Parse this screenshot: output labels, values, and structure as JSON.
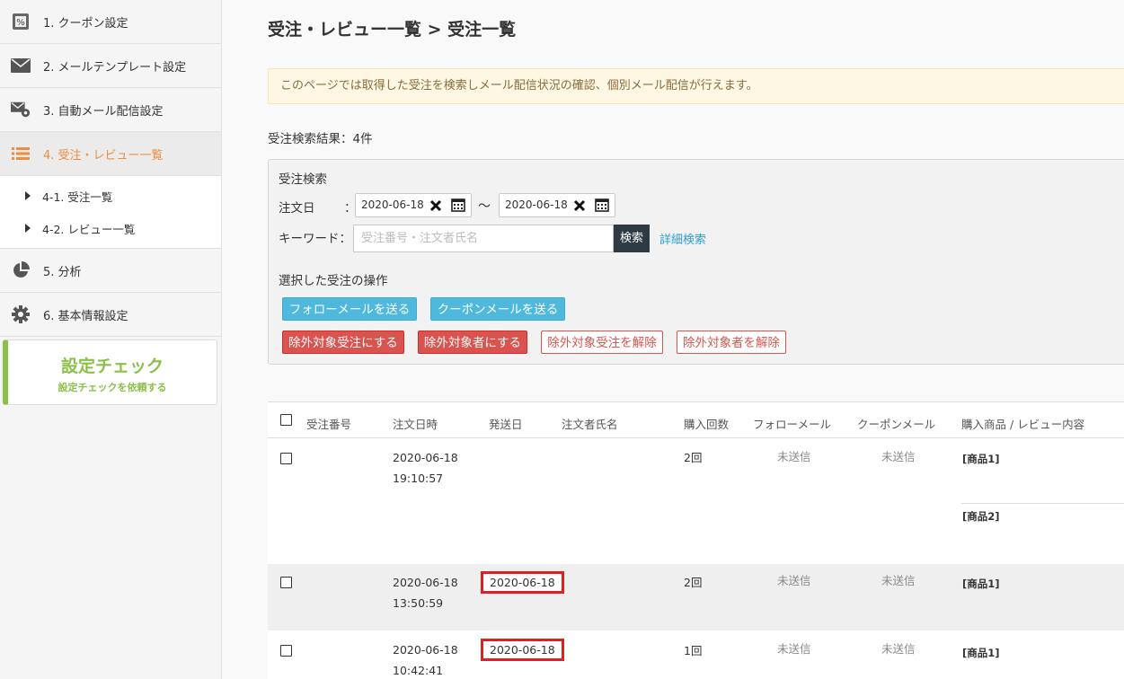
{
  "sidebar": {
    "items": [
      {
        "label": "1. クーポン設定",
        "icon": "coupon-icon"
      },
      {
        "label": "2. メールテンプレート設定",
        "icon": "mail-icon"
      },
      {
        "label": "3. 自動メール配信設定",
        "icon": "mail-gear-icon"
      },
      {
        "label": "4. 受注・レビュー一覧",
        "icon": "list-icon"
      },
      {
        "label": "5. 分析",
        "icon": "pie-chart-icon"
      },
      {
        "label": "6. 基本情報設定",
        "icon": "gear-icon"
      }
    ],
    "sub_items": [
      {
        "label": "4-1. 受注一覧"
      },
      {
        "label": "4-2. レビュー一覧"
      }
    ],
    "check": {
      "title": "設定チェック",
      "subtitle": "設定チェックを依頼する",
      "accent": "#8ac249"
    },
    "active_color": "#f08c3c"
  },
  "main": {
    "title": "受注・レビュー一覧 > 受注一覧",
    "notice": "このページでは取得した受注を検索しメール配信状況の確認、個別メール配信が行えます。",
    "result_count": "受注検索結果：4件"
  },
  "search": {
    "title": "受注検索",
    "date_label": "注文日",
    "colon": "：",
    "date_from": "2020-06-18",
    "date_to": "2020-06-18",
    "tilde": "～",
    "keyword_label": "キーワード：",
    "keyword_placeholder": "受注番号・注文者氏名",
    "search_button": "検索",
    "detail_link": "詳細検索",
    "ops_title": "選択した受注の操作",
    "buttons": {
      "follow_mail": "フォローメールを送る",
      "coupon_mail": "クーポンメールを送る",
      "exclude_order": "除外対象受注にする",
      "exclude_person": "除外対象者にする",
      "unexclude_order": "除外対象受注を解除",
      "unexclude_person": "除外対象者を解除"
    }
  },
  "table": {
    "headers": {
      "order_no": "受注番号",
      "order_date": "注文日時",
      "ship_date": "発送日",
      "name": "注文者氏名",
      "count": "購入回数",
      "follow": "フォローメール",
      "coupon": "クーポンメール",
      "product": "購入商品 / レビュー内容"
    },
    "rows": [
      {
        "date": "2020-06-18",
        "time": "19:10:57",
        "ship": "",
        "count": "2回",
        "follow": "未送信",
        "coupon": "未送信",
        "product1": "[商品1]",
        "product2": "[商品2]"
      },
      {
        "date": "2020-06-18",
        "time": "13:50:59",
        "ship": "2020-06-18",
        "count": "2回",
        "follow": "未送信",
        "coupon": "未送信",
        "product1": "[商品1]"
      },
      {
        "date": "2020-06-18",
        "time": "10:42:41",
        "ship": "2020-06-18",
        "count": "1回",
        "follow": "未送信",
        "coupon": "未送信",
        "product1": "[商品1]"
      }
    ]
  }
}
